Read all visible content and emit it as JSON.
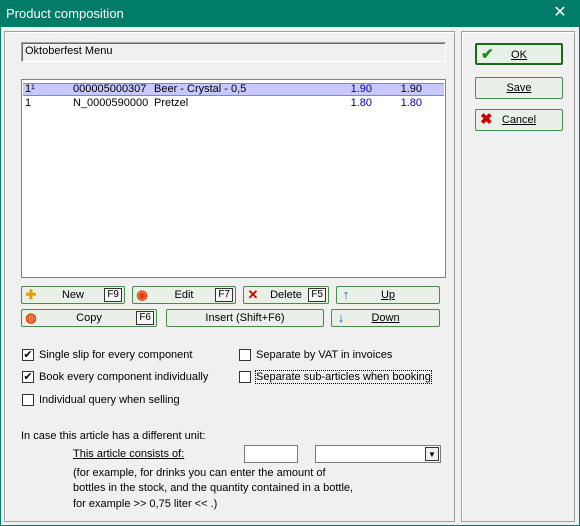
{
  "window": {
    "title": "Product composition",
    "close_glyph": "✕"
  },
  "composite_name": "Oktoberfest Menu",
  "components": [
    {
      "qty": "1¹",
      "code": "000005000307",
      "name": "Beer - Crystal - 0,5",
      "price": "1.90",
      "total": "1.90",
      "selected": true
    },
    {
      "qty": "1",
      "code": "N_0000590000",
      "name": "Pretzel",
      "price": "1.80",
      "total": "1.80",
      "selected": false
    }
  ],
  "buttons": {
    "new": {
      "label": "New",
      "key": "F9",
      "icon": "plus-icon"
    },
    "edit": {
      "label": "Edit",
      "key": "F7",
      "icon": "edit-icon"
    },
    "delete": {
      "label": "Delete",
      "key": "F5",
      "icon": "delete-icon"
    },
    "up": {
      "label": "Up",
      "icon": "arrow-up-icon"
    },
    "copy": {
      "label": "Copy",
      "key": "F6",
      "icon": "copy-icon"
    },
    "insert": {
      "label": "Insert (Shift+F6)"
    },
    "down": {
      "label": "Down",
      "icon": "arrow-down-icon"
    }
  },
  "side": {
    "ok": {
      "label": "OK",
      "icon": "check-icon"
    },
    "save": {
      "label": "Save"
    },
    "cancel": {
      "label": "Cancel",
      "icon": "cancel-icon"
    }
  },
  "options": {
    "single_slip": {
      "label": "Single slip for every component",
      "checked": true
    },
    "book_individually": {
      "label": "Book every component individually",
      "checked": true
    },
    "individual_query": {
      "label": "Individual query when selling",
      "checked": false
    },
    "separate_vat": {
      "label": "Separate by VAT in invoices",
      "checked": false
    },
    "separate_subarticles": {
      "label": "Separate sub-articles when booking",
      "checked": false
    }
  },
  "unit": {
    "heading": "In case this article has a different unit:",
    "consists_of": "This article consists of:",
    "quantity_value": "",
    "unit_selected": "",
    "help_line1": "(for example, for drinks you can enter the amount of",
    "help_line2": "bottles in the stock, and the quantity contained in a bottle,",
    "help_line3": "for example >> 0,75 liter << .)"
  },
  "colors": {
    "titlebar": "#017c68",
    "price_text": "#0000a0",
    "selection": "#c8c8ff"
  }
}
